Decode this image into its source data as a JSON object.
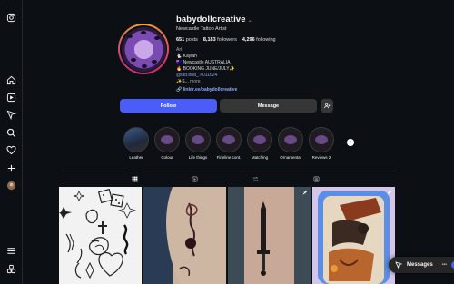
{
  "sidebar": {
    "icons": [
      "instagram-icon",
      "home-icon",
      "reels-icon",
      "explore-icon",
      "search-icon",
      "heart-icon",
      "create-icon",
      "profile-avatar-icon",
      "menu-icon",
      "more-icon"
    ]
  },
  "profile": {
    "username": "babydollcreative",
    "chevron": "⌄",
    "subtitle": "Newcastle Tattoo Artist",
    "stats": {
      "posts_value": "651",
      "posts_label": "posts",
      "followers_value": "8,183",
      "followers_label": "followers",
      "following_value": "4,296",
      "following_label": "following"
    },
    "bio": {
      "category": "Art",
      "line1": "🐇 Kaylah",
      "line2": "🇦🇺 Newcastle AUSTRALIA",
      "line3": "🔥 BOOKING JUNE/JULY✨",
      "line4": "@tatt.brat_ #011624",
      "line5_prefix": "✨S...",
      "more": "more",
      "link": "linktr.ee/babydollcreative"
    }
  },
  "buttons": {
    "follow": "Follow",
    "message": "Message",
    "add_user_icon": "add-user-icon"
  },
  "highlights": [
    {
      "label": "Leather"
    },
    {
      "label": "Colour"
    },
    {
      "label": "Life things"
    },
    {
      "label": "Fineline cont."
    },
    {
      "label": "Matching"
    },
    {
      "label": "Ornamental"
    },
    {
      "label": "Reviews 2"
    }
  ],
  "tabs": [
    "posts-grid-icon",
    "reels-tab-icon",
    "reposts-tab-icon",
    "tagged-tab-icon"
  ],
  "messages_pill": {
    "label": "Messages",
    "dots": "•••"
  },
  "colors": {
    "background": "#0c1014",
    "follow_button": "#4a5df9",
    "secondary_button": "#363636",
    "link": "#8aa7ff"
  }
}
